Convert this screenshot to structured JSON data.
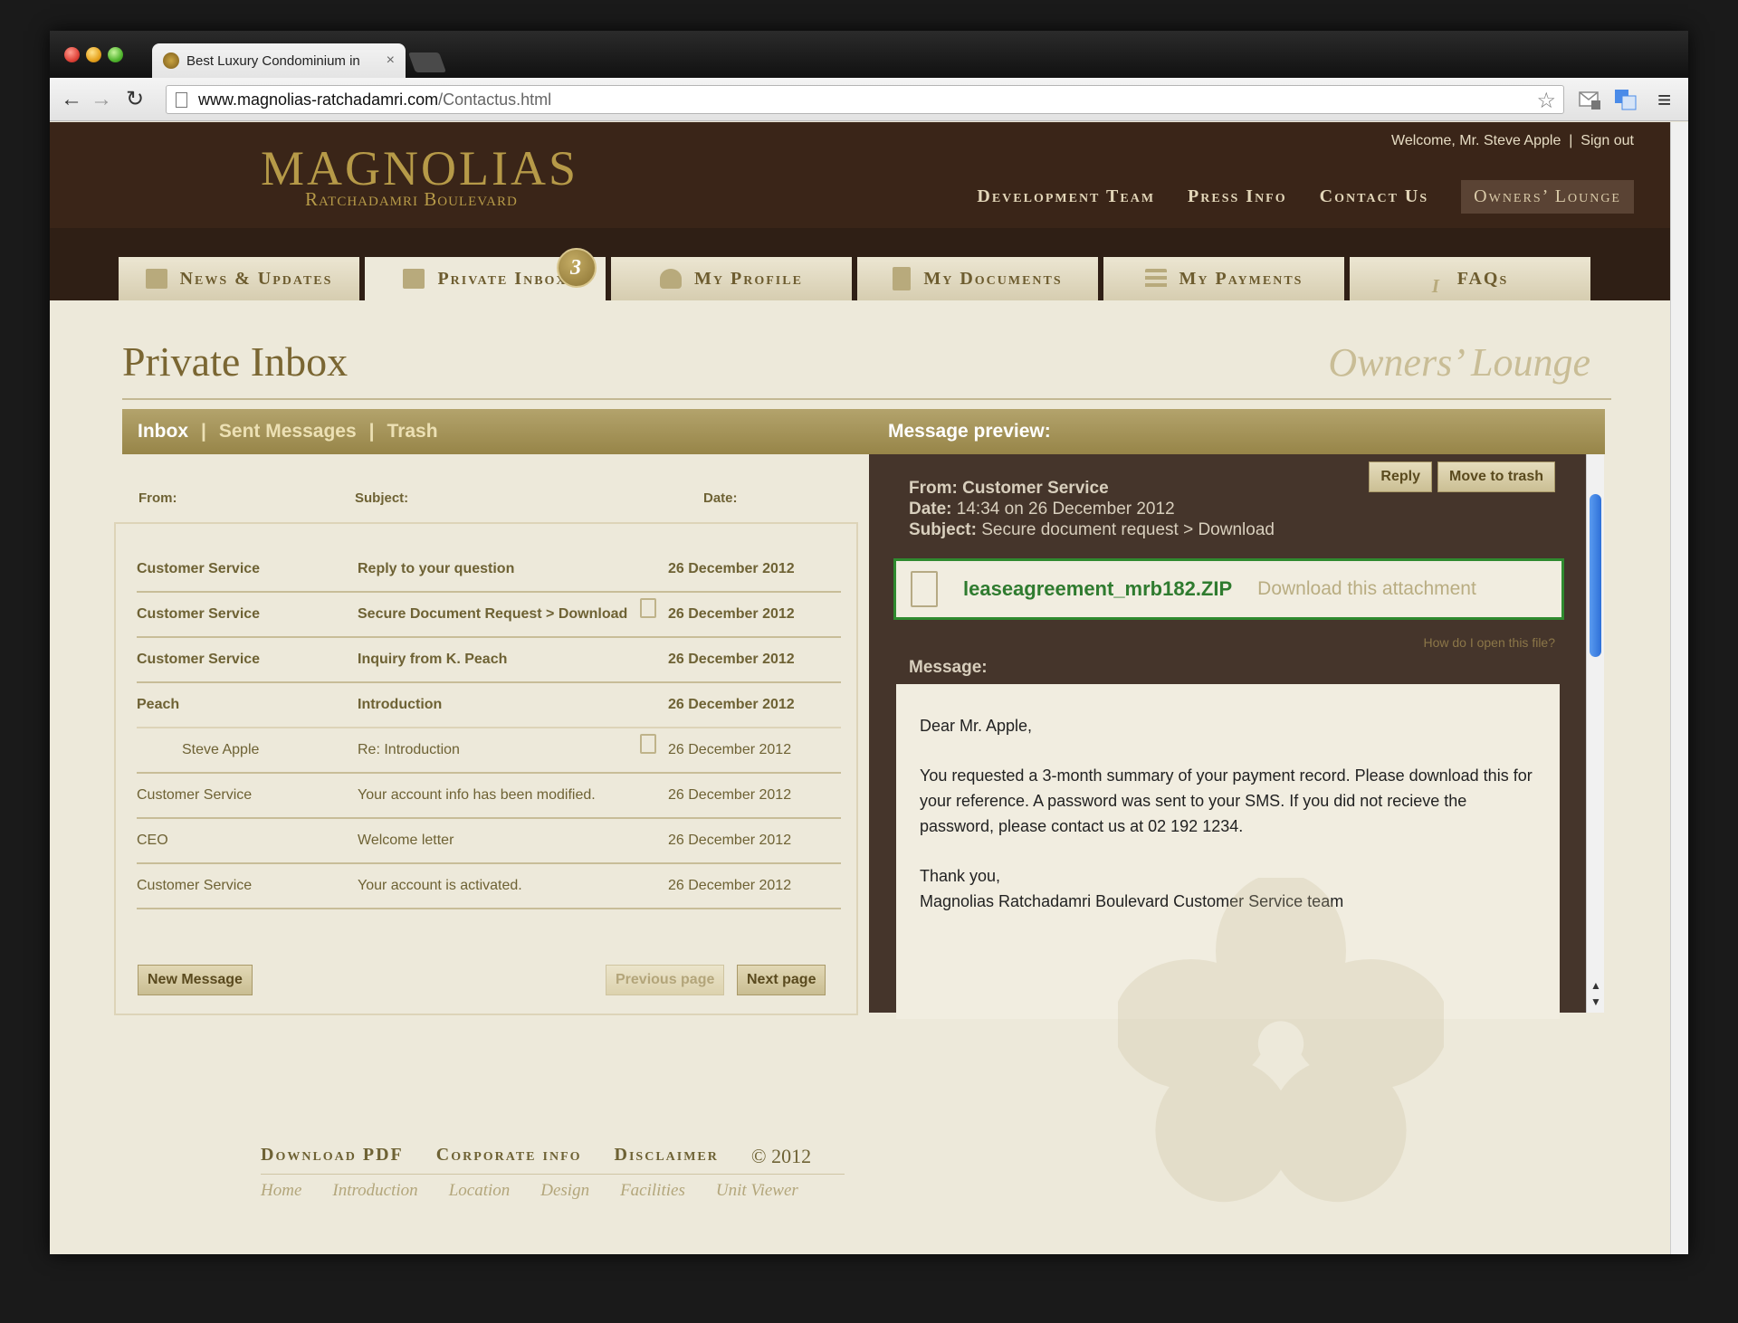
{
  "browser": {
    "tab_title": "Best Luxury Condominium in",
    "tab_close": "×",
    "url_host": "www.magnolias-ratchadamri.com",
    "url_path": "/Contactus.html",
    "back_icon": "←",
    "forward_icon": "→",
    "reload_icon": "↻",
    "star_icon": "☆",
    "menu_icon": "≡"
  },
  "header": {
    "logo_main": "MAGNOLIAS",
    "logo_sub": "Ratchadamri Boulevard",
    "welcome_text": "Welcome, Mr. Steve Apple",
    "welcome_sep": "|",
    "sign_out": "Sign out",
    "nav": [
      "Development Team",
      "Press Info",
      "Contact Us",
      "Owners’ Lounge"
    ]
  },
  "tabs": [
    {
      "label": "News & Updates",
      "icon": "calendar-icon"
    },
    {
      "label": "Private Inbox",
      "icon": "envelope-icon",
      "badge": "3"
    },
    {
      "label": "My Profile",
      "icon": "person-icon"
    },
    {
      "label": "My Documents",
      "icon": "document-icon"
    },
    {
      "label": "My Payments",
      "icon": "list-icon"
    },
    {
      "label": "FAQs",
      "icon": "info-icon",
      "glyph": "i"
    }
  ],
  "page": {
    "title": "Private Inbox",
    "subtitle": "Owners’ Lounge"
  },
  "mailbar": {
    "inbox": "Inbox",
    "sent": "Sent Messages",
    "trash": "Trash",
    "sep": "|",
    "preview_title": "Message preview:"
  },
  "inbox": {
    "col_from": "From:",
    "col_subject": "Subject:",
    "col_date": "Date:",
    "rows": [
      {
        "from": "Customer Service",
        "subject": "Reply to your question",
        "date": "26 December 2012"
      },
      {
        "from": "Customer Service",
        "subject": "Secure Document Request > Download",
        "date": "26 December 2012"
      },
      {
        "from": "Customer Service",
        "subject": "Inquiry from K. Peach",
        "date": "26 December 2012"
      },
      {
        "from": "Peach",
        "subject": "Introduction",
        "date": "26 December 2012"
      },
      {
        "from": "Steve Apple",
        "subject": "Re: Introduction",
        "date": "26 December 2012"
      },
      {
        "from": "Customer Service",
        "subject": "Your account info has been modified.",
        "date": "26 December 2012"
      },
      {
        "from": "CEO",
        "subject": "Welcome letter",
        "date": "26 December 2012"
      },
      {
        "from": "Customer Service",
        "subject": "Your account is activated.",
        "date": "26 December 2012"
      }
    ],
    "new_message": "New Message",
    "previous_page": "Previous page",
    "next_page": "Next page"
  },
  "preview": {
    "reply": "Reply",
    "move_to_trash": "Move to trash",
    "from_label": "From:",
    "from_value": "Customer Service",
    "date_label": "Date:",
    "date_value": "14:34 on 26 December 2012",
    "subject_label": "Subject:",
    "subject_value": "Secure document request > Download",
    "attachment_name": "leaseagreement_mrb182.ZIP",
    "attachment_link": "Download this attachment",
    "howto": "How do I open this file?",
    "message_label": "Message:",
    "greeting": "Dear Mr. Apple,",
    "body": "You requested a 3-month summary of your payment record. Please download this for your reference. A password was sent to your SMS. If you did not recieve the password, please contact us at 02 192 1234.",
    "closing": "Thank you,",
    "signature": "Magnolias Ratchadamri Boulevard Customer Service team",
    "scroll_up": "▲",
    "scroll_down": "▼"
  },
  "footer": {
    "links": [
      "Download PDF",
      "Corporate info",
      "Disclaimer"
    ],
    "copyright": "© 2012",
    "sub_links": [
      "Home",
      "Introduction",
      "Location",
      "Design",
      "Facilities",
      "Unit Viewer"
    ]
  }
}
